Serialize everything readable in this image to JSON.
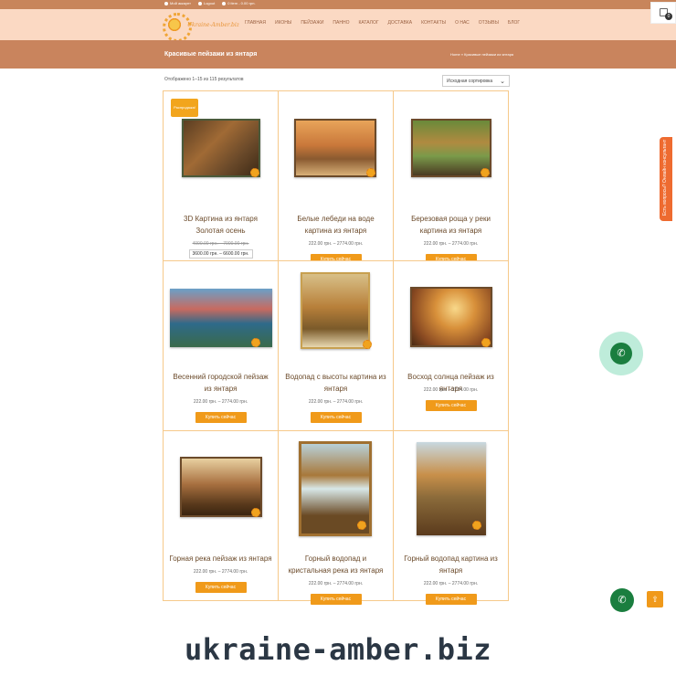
{
  "topbar": {
    "account": "Мой аккаунт",
    "logout": "Logout",
    "cart": "0 item - 0.00 грн."
  },
  "header": {
    "logo_text": "Ukraine-Amber.biz",
    "nav": [
      "ГЛАВНАЯ",
      "ИКОНЫ",
      "ПЕЙЗАЖИ",
      "ПАННО",
      "КАТАЛОГ",
      "ДОСТАВКА",
      "КОНТАКТЫ",
      "О НАС",
      "ОТЗЫВЫ",
      "БЛОГ"
    ],
    "cart_count": "0"
  },
  "titlebar": {
    "title": "Красивые пейзажи из янтаря",
    "breadcrumb": "Home » Красивые пейзажи из янтаря"
  },
  "shop": {
    "results": "Отображено 1–15 из 115 результатов",
    "sort_selected": "Исходная сортировка",
    "sale_badge": "Распродажа!",
    "buy_label": "Купить сейчас"
  },
  "products": [
    {
      "name": "3D Картина из янтаря Золотая осень",
      "old_price": "4000.00 грн. – 7000.00 грн.",
      "price": "3600.00 грн. – 6600.00 грн.",
      "sale": true
    },
    {
      "name": "Белые лебеди на воде картина из янтаря",
      "price": "222.00 грн. – 2774.00 грн."
    },
    {
      "name": "Березовая роща у реки картина из янтаря",
      "price": "222.00 грн. – 2774.00 грн."
    },
    {
      "name": "Весенний городской пейзаж из янтаря",
      "price": "222.00 грн. – 2774.00 грн."
    },
    {
      "name": "Водопад с высоты картина из янтаря",
      "price": "222.00 грн. – 2774.00 грн."
    },
    {
      "name": "Восход солнца пейзаж из янтаря",
      "price": "222.00 грн. – 2774.00 грн."
    },
    {
      "name": "Горная река пейзаж из янтаря",
      "price": "222.00 грн. – 2774.00 грн."
    },
    {
      "name": "Горный водопад и кристальная река из янтаря",
      "price": "222.00 грн. – 2774.00 грн."
    },
    {
      "name": "Горный водопад картина из янтаря",
      "price": "222.00 грн. – 2774.00 грн."
    }
  ],
  "widgets": {
    "side_tab": "Есть вопросы? Онлайн консультант"
  },
  "footer": {
    "domain": "ukraine-amber.biz"
  },
  "colors": {
    "accent": "#f09a1a",
    "header_bg": "#fbd9c3",
    "titlebar_bg": "#c9845d",
    "card_border": "#f6c98a",
    "call_green": "#1a7e3f"
  }
}
